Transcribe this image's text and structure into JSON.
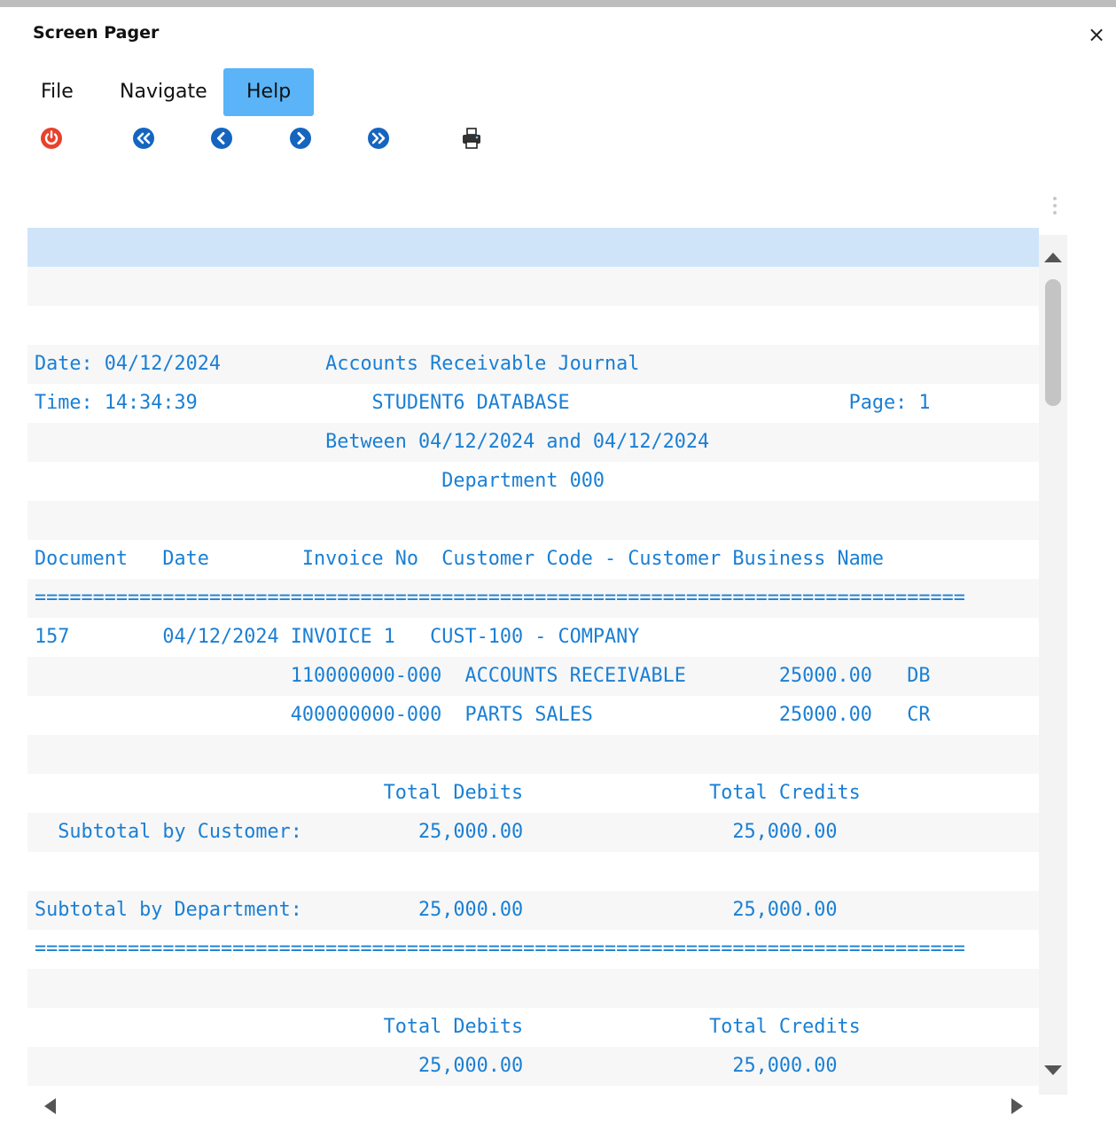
{
  "window": {
    "title": "Screen Pager",
    "close": "×"
  },
  "menu": [
    "File",
    "Navigate",
    "Help"
  ],
  "toolbar": [
    "power-icon",
    "first-page-icon",
    "prev-page-icon",
    "next-page-icon",
    "last-page-icon",
    "print-icon"
  ],
  "colors": {
    "accent": "#5ab4f7",
    "report_text": "#1a7fd4",
    "selected_row": "#cfe4f8"
  },
  "report_lines": [
    "",
    "",
    "",
    "Date: 04/12/2024         Accounts Receivable Journal",
    "Time: 14:34:39               STUDENT6 DATABASE                        Page: 1",
    "                         Between 04/12/2024 and 04/12/2024",
    "                                   Department 000",
    "",
    "Document   Date        Invoice No  Customer Code - Customer Business Name",
    "================================================================================",
    "157        04/12/2024 INVOICE 1   CUST-100 - COMPANY",
    "                      110000000-000  ACCOUNTS RECEIVABLE        25000.00   DB",
    "                      400000000-000  PARTS SALES                25000.00   CR",
    "",
    "                              Total Debits                Total Credits",
    "  Subtotal by Customer:          25,000.00                  25,000.00",
    "",
    "Subtotal by Department:          25,000.00                  25,000.00",
    "================================================================================",
    "",
    "                              Total Debits                Total Credits",
    "                                 25,000.00                  25,000.00"
  ]
}
